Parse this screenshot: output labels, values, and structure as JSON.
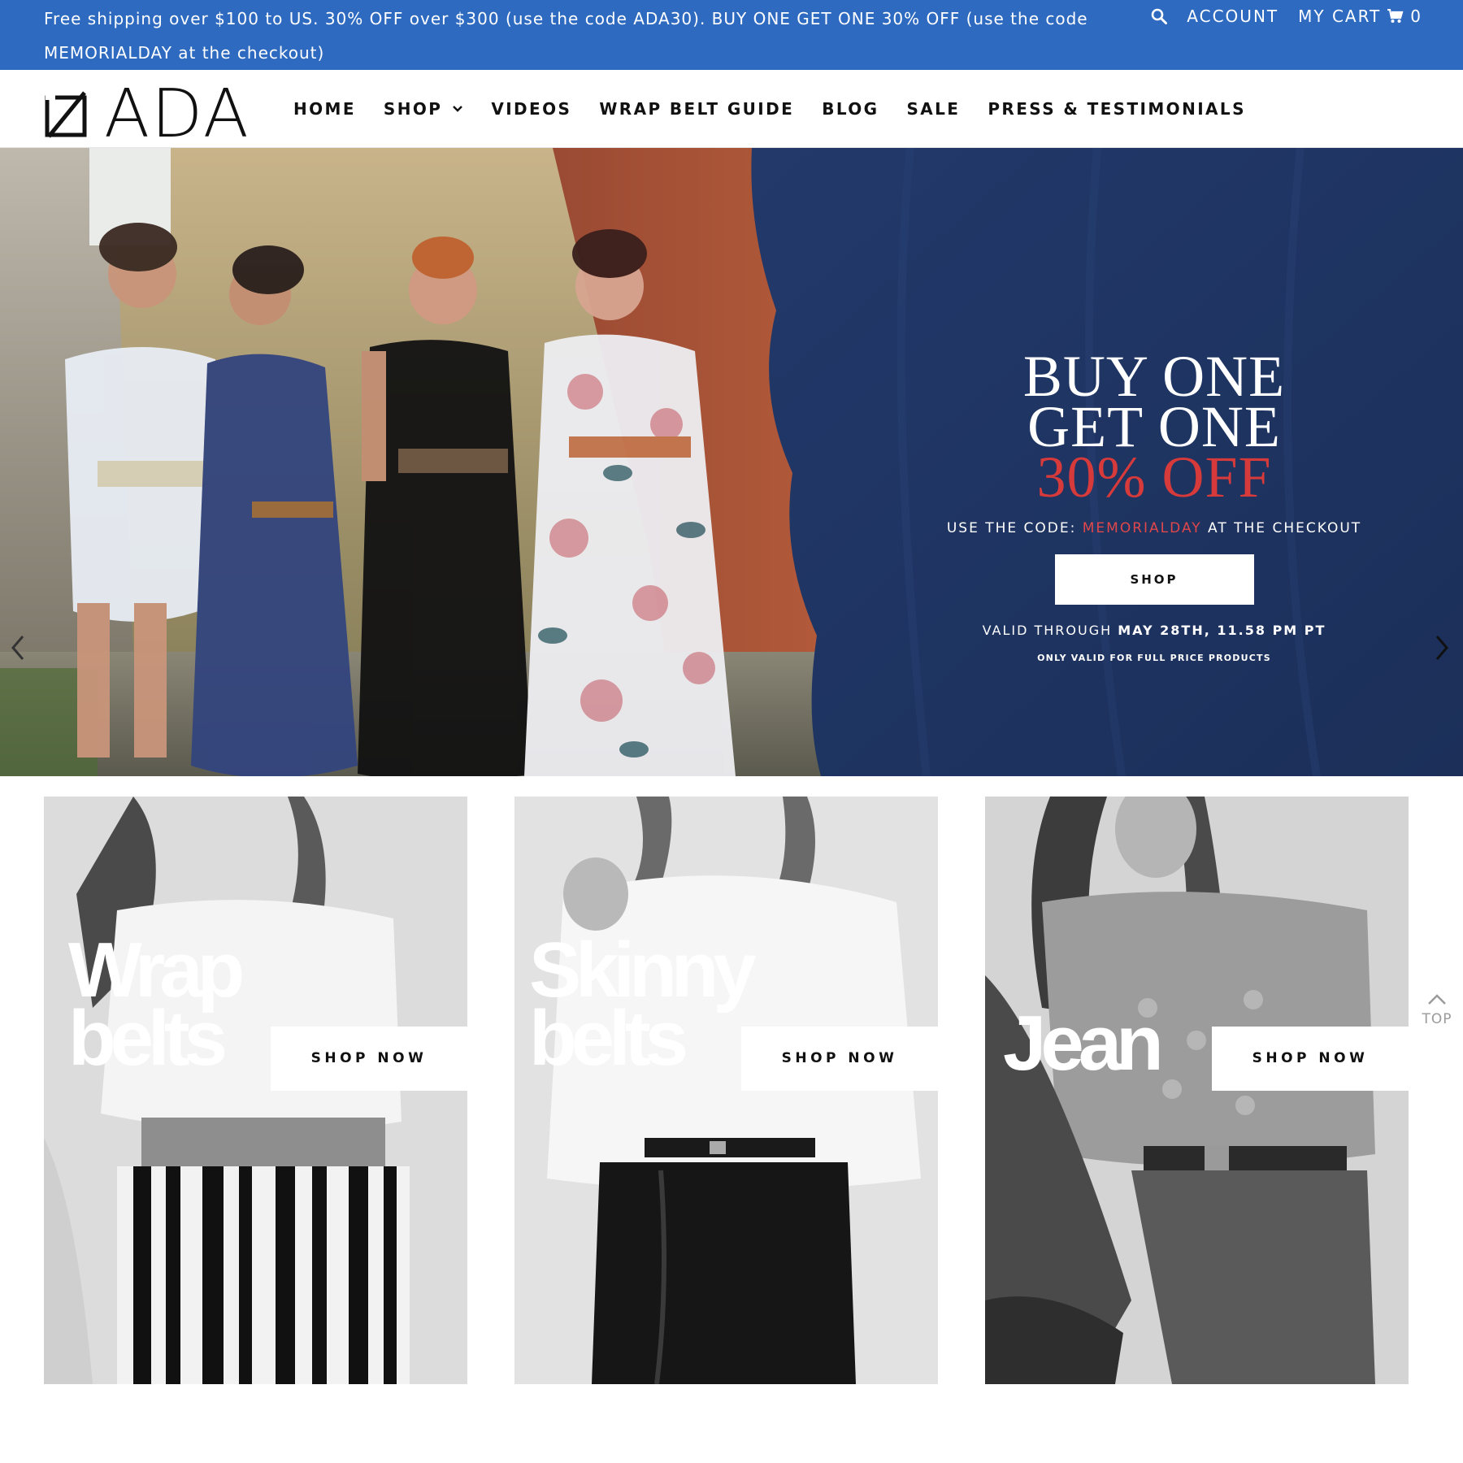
{
  "announcement": {
    "text": "Free shipping over $100 to US. 30% OFF over $300 (use the code ADA30). BUY ONE GET ONE 30% OFF (use the code MEMORIALDAY at the checkout)"
  },
  "utility_nav": {
    "search_icon": "search-icon",
    "account_label": "ACCOUNT",
    "cart_label": "MY CART",
    "cart_icon": "cart-icon",
    "cart_count": "0"
  },
  "brand": {
    "logo_text": "ADA"
  },
  "nav": {
    "items": [
      {
        "label": "HOME"
      },
      {
        "label": "SHOP"
      },
      {
        "label": "VIDEOS"
      },
      {
        "label": "WRAP BELT GUIDE"
      },
      {
        "label": "BLOG"
      },
      {
        "label": "SALE"
      },
      {
        "label": "PRESS & TESTIMONIALS"
      }
    ]
  },
  "hero": {
    "line1": "BUY ONE",
    "line2": "GET ONE",
    "line3": "30% OFF",
    "code_prefix": "USE THE CODE:",
    "code": "MEMORIALDAY",
    "code_suffix": "AT THE CHECKOUT",
    "button_label": "SHOP",
    "valid_prefix": "VALID THROUGH",
    "valid_date": "MAY 28TH, 11.58 PM PT",
    "fine_print": "ONLY VALID FOR FULL PRICE PRODUCTS"
  },
  "categories": [
    {
      "title": "Wrap\nbelts",
      "button": "SHOP NOW"
    },
    {
      "title": "Skinny\nbelts",
      "button": "SHOP NOW"
    },
    {
      "title": "Jean",
      "button": "SHOP NOW"
    }
  ],
  "back_to_top": {
    "label": "TOP"
  },
  "colors": {
    "announcement_bg": "#2d6ac0",
    "hero_navy": "#1f3561",
    "promo_red": "#d63a3a",
    "code_red": "#e0474b"
  }
}
